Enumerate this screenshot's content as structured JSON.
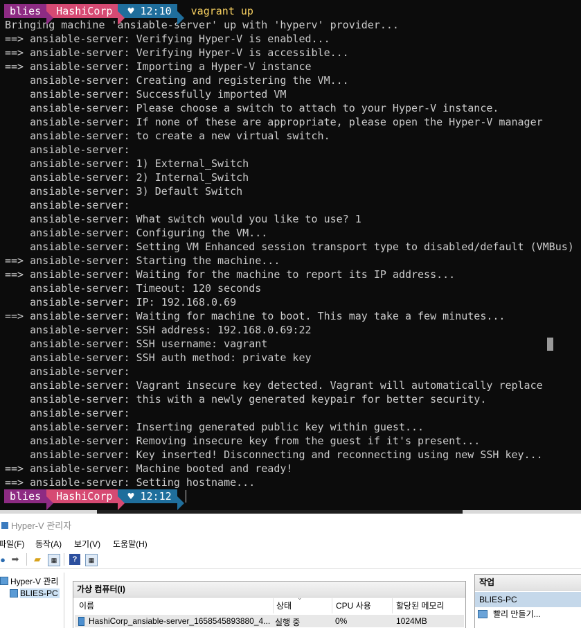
{
  "colors": {
    "terminal_bg": "#0c0c0c",
    "terminal_fg": "#cccccc",
    "prompt_user_bg": "#8d2b83",
    "prompt_git_bg": "#d64a73",
    "prompt_time_bg": "#1f6e9c",
    "command_fg": "#f7d060"
  },
  "terminal": {
    "prompt1": {
      "user": "blies",
      "git": "HashiCorp",
      "time": "♥ 12:10",
      "command": "vagrant up"
    },
    "lines": [
      "Bringing machine 'ansiable-server' up with 'hyperv' provider...",
      "==> ansiable-server: Verifying Hyper-V is enabled...",
      "==> ansiable-server: Verifying Hyper-V is accessible...",
      "==> ansiable-server: Importing a Hyper-V instance",
      "    ansiable-server: Creating and registering the VM...",
      "    ansiable-server: Successfully imported VM",
      "    ansiable-server: Please choose a switch to attach to your Hyper-V instance.",
      "    ansiable-server: If none of these are appropriate, please open the Hyper-V manager",
      "    ansiable-server: to create a new virtual switch.",
      "    ansiable-server:",
      "    ansiable-server: 1) External_Switch",
      "    ansiable-server: 2) Internal_Switch",
      "    ansiable-server: 3) Default Switch",
      "    ansiable-server:",
      "    ansiable-server: What switch would you like to use? 1",
      "    ansiable-server: Configuring the VM...",
      "    ansiable-server: Setting VM Enhanced session transport type to disabled/default (VMBus)",
      "==> ansiable-server: Starting the machine...",
      "==> ansiable-server: Waiting for the machine to report its IP address...",
      "    ansiable-server: Timeout: 120 seconds",
      "    ansiable-server: IP: 192.168.0.69",
      "==> ansiable-server: Waiting for machine to boot. This may take a few minutes...",
      "    ansiable-server: SSH address: 192.168.0.69:22",
      "    ansiable-server: SSH username: vagrant",
      "    ansiable-server: SSH auth method: private key",
      "    ansiable-server:",
      "    ansiable-server: Vagrant insecure key detected. Vagrant will automatically replace",
      "    ansiable-server: this with a newly generated keypair for better security.",
      "    ansiable-server:",
      "    ansiable-server: Inserting generated public key within guest...",
      "    ansiable-server: Removing insecure key from the guest if it's present...",
      "    ansiable-server: Key inserted! Disconnecting and reconnecting using new SSH key...",
      "==> ansiable-server: Machine booted and ready!",
      "==> ansiable-server: Setting hostname..."
    ],
    "prompt2": {
      "user": "blies",
      "git": "HashiCorp",
      "time": "♥ 12:12"
    }
  },
  "hyperv": {
    "window_title": "Hyper-V 관리자",
    "menu": [
      "파일(F)",
      "동작(A)",
      "보기(V)",
      "도움말(H)"
    ],
    "toolbar_icons": [
      "back-icon",
      "forward-icon",
      "folder-up-icon",
      "console-tree-icon",
      "help-icon",
      "action-pane-icon"
    ],
    "tree": {
      "root": "Hyper-V 관리",
      "server": "BLIES-PC"
    },
    "center_title": "가상 컴퓨터(I)",
    "columns": [
      "이름",
      "상태",
      "CPU 사용",
      "할당된 메모리"
    ],
    "rows": [
      {
        "name": "HashiCorp_ansiable-server_1658545893880_4...",
        "state": "실행 중",
        "cpu": "0%",
        "memory": "1024MB"
      }
    ],
    "actions_title": "작업",
    "actions_server": "BLIES-PC",
    "actions_first": "빨리 만들기..."
  }
}
